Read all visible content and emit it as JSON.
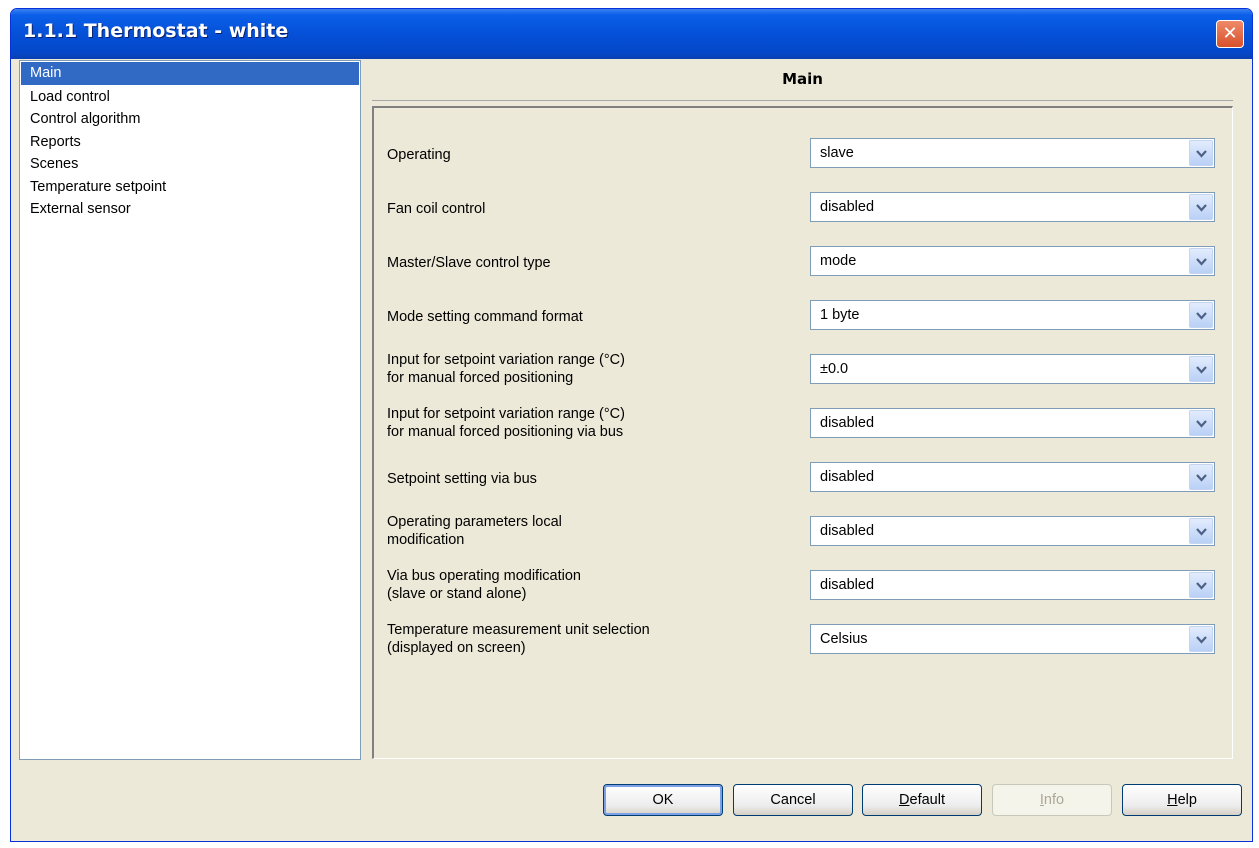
{
  "window": {
    "title": "1.1.1 Thermostat - white",
    "close_glyph": "✕"
  },
  "nav": {
    "items": [
      {
        "label": "Main",
        "selected": true
      },
      {
        "label": "Load control"
      },
      {
        "label": "Control algorithm"
      },
      {
        "label": "Reports"
      },
      {
        "label": "Scenes"
      },
      {
        "label": "Temperature setpoint"
      },
      {
        "label": "External sensor"
      }
    ]
  },
  "panel": {
    "title": "Main",
    "params": [
      {
        "label": [
          "Operating"
        ],
        "value": "slave"
      },
      {
        "label": [
          "Fan coil control"
        ],
        "value": "disabled"
      },
      {
        "label": [
          "Master/Slave control type"
        ],
        "value": "mode"
      },
      {
        "label": [
          "Mode setting command format"
        ],
        "value": "1 byte"
      },
      {
        "label": [
          "Input for setpoint variation range (°C)",
          "for manual forced positioning"
        ],
        "value": "±0.0"
      },
      {
        "label": [
          "Input for setpoint variation range (°C)",
          "for manual forced positioning via bus"
        ],
        "value": "disabled"
      },
      {
        "label": [
          "Setpoint setting via bus"
        ],
        "value": "disabled"
      },
      {
        "label": [
          "Operating parameters local",
          "modification"
        ],
        "value": "disabled"
      },
      {
        "label": [
          "Via bus operating modification",
          "(slave or stand alone)"
        ],
        "value": "disabled"
      },
      {
        "label": [
          "Temperature measurement unit selection",
          "(displayed on screen)"
        ],
        "value": "Celsius"
      }
    ]
  },
  "buttons": {
    "ok": "OK",
    "cancel": "Cancel",
    "default_first": "D",
    "default_rest": "efault",
    "info_first": "I",
    "info_rest": "nfo",
    "help_first": "H",
    "help_rest": "elp"
  },
  "colors": {
    "titlebar": "#0550d8",
    "selection": "#316ac5",
    "dialog_bg": "#ece9d8"
  }
}
